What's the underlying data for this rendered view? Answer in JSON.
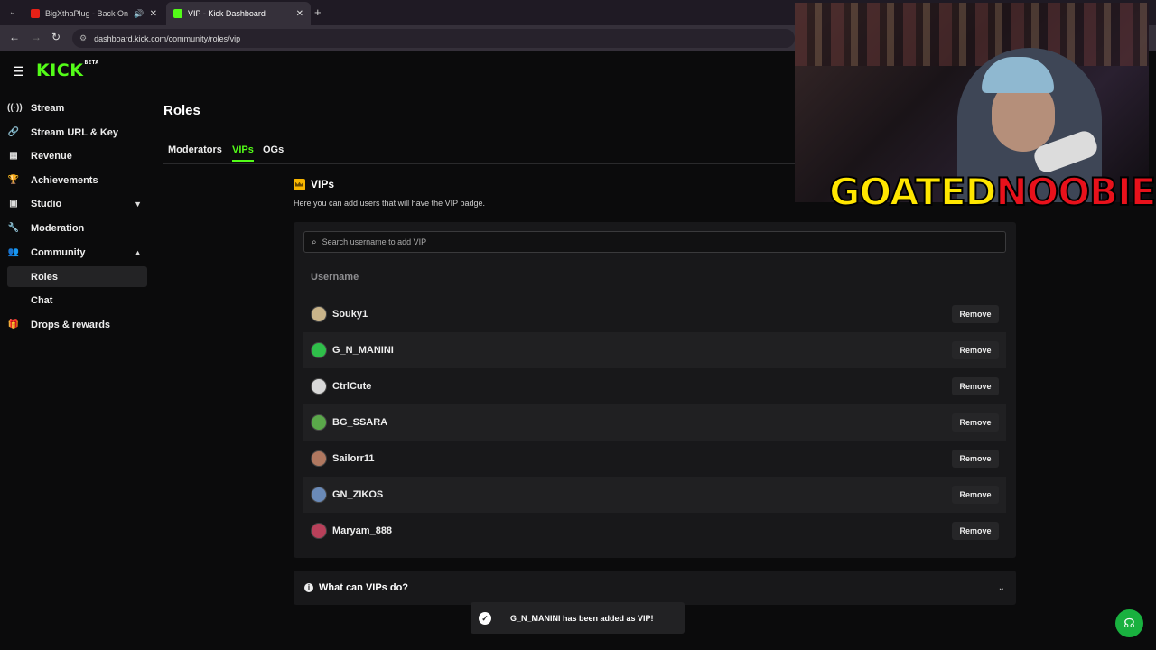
{
  "browser": {
    "tabs": [
      {
        "title": "BigXthaPlug - Back On My",
        "active": false
      },
      {
        "title": "VIP - Kick Dashboard",
        "active": true
      }
    ],
    "new_tab": "+",
    "url": "dashboard.kick.com/community/roles/vip"
  },
  "sidebar": {
    "logo": "KICK",
    "logo_badge": "BETA",
    "items": [
      {
        "label": "Stream",
        "icon": "broadcast-icon"
      },
      {
        "label": "Stream URL & Key",
        "icon": "link-icon"
      },
      {
        "label": "Revenue",
        "icon": "chart-icon"
      },
      {
        "label": "Achievements",
        "icon": "trophy-icon"
      },
      {
        "label": "Studio",
        "icon": "studio-icon"
      },
      {
        "label": "Moderation",
        "icon": "wrench-icon"
      },
      {
        "label": "Community",
        "icon": "users-icon"
      },
      {
        "label": "Roles",
        "icon": ""
      },
      {
        "label": "Chat",
        "icon": ""
      },
      {
        "label": "Drops & rewards",
        "icon": "gift-icon"
      }
    ]
  },
  "main": {
    "title": "Roles",
    "tabs": [
      {
        "label": "Moderators"
      },
      {
        "label": "VIPs"
      },
      {
        "label": "OGs"
      }
    ],
    "section_title": "VIPs",
    "section_desc": "Here you can add users that will have the VIP badge.",
    "search_placeholder": "Search username to add VIP",
    "column_header": "Username",
    "remove_label": "Remove",
    "users": [
      {
        "name": "Souky1",
        "avatar_color": "#c9b48a"
      },
      {
        "name": "G_N_MANINI",
        "avatar_color": "#2fbf4a"
      },
      {
        "name": "CtrlCute",
        "avatar_color": "#d8d8d8"
      },
      {
        "name": "BG_SSARA",
        "avatar_color": "#5aa84a"
      },
      {
        "name": "Sailorr11",
        "avatar_color": "#b07860"
      },
      {
        "name": "GN_ZIKOS",
        "avatar_color": "#6a8ab8"
      },
      {
        "name": "Maryam_888",
        "avatar_color": "#b8405a"
      }
    ],
    "faq_title": "What can VIPs do?"
  },
  "toast": {
    "message": "G_N_MANINI has been added as VIP!"
  },
  "overlay": {
    "brand_left": "GOATED",
    "brand_right": "NOOBIE"
  },
  "colors": {
    "accent": "#53fc18",
    "crown": "#f7b500",
    "help": "#19b13f"
  }
}
